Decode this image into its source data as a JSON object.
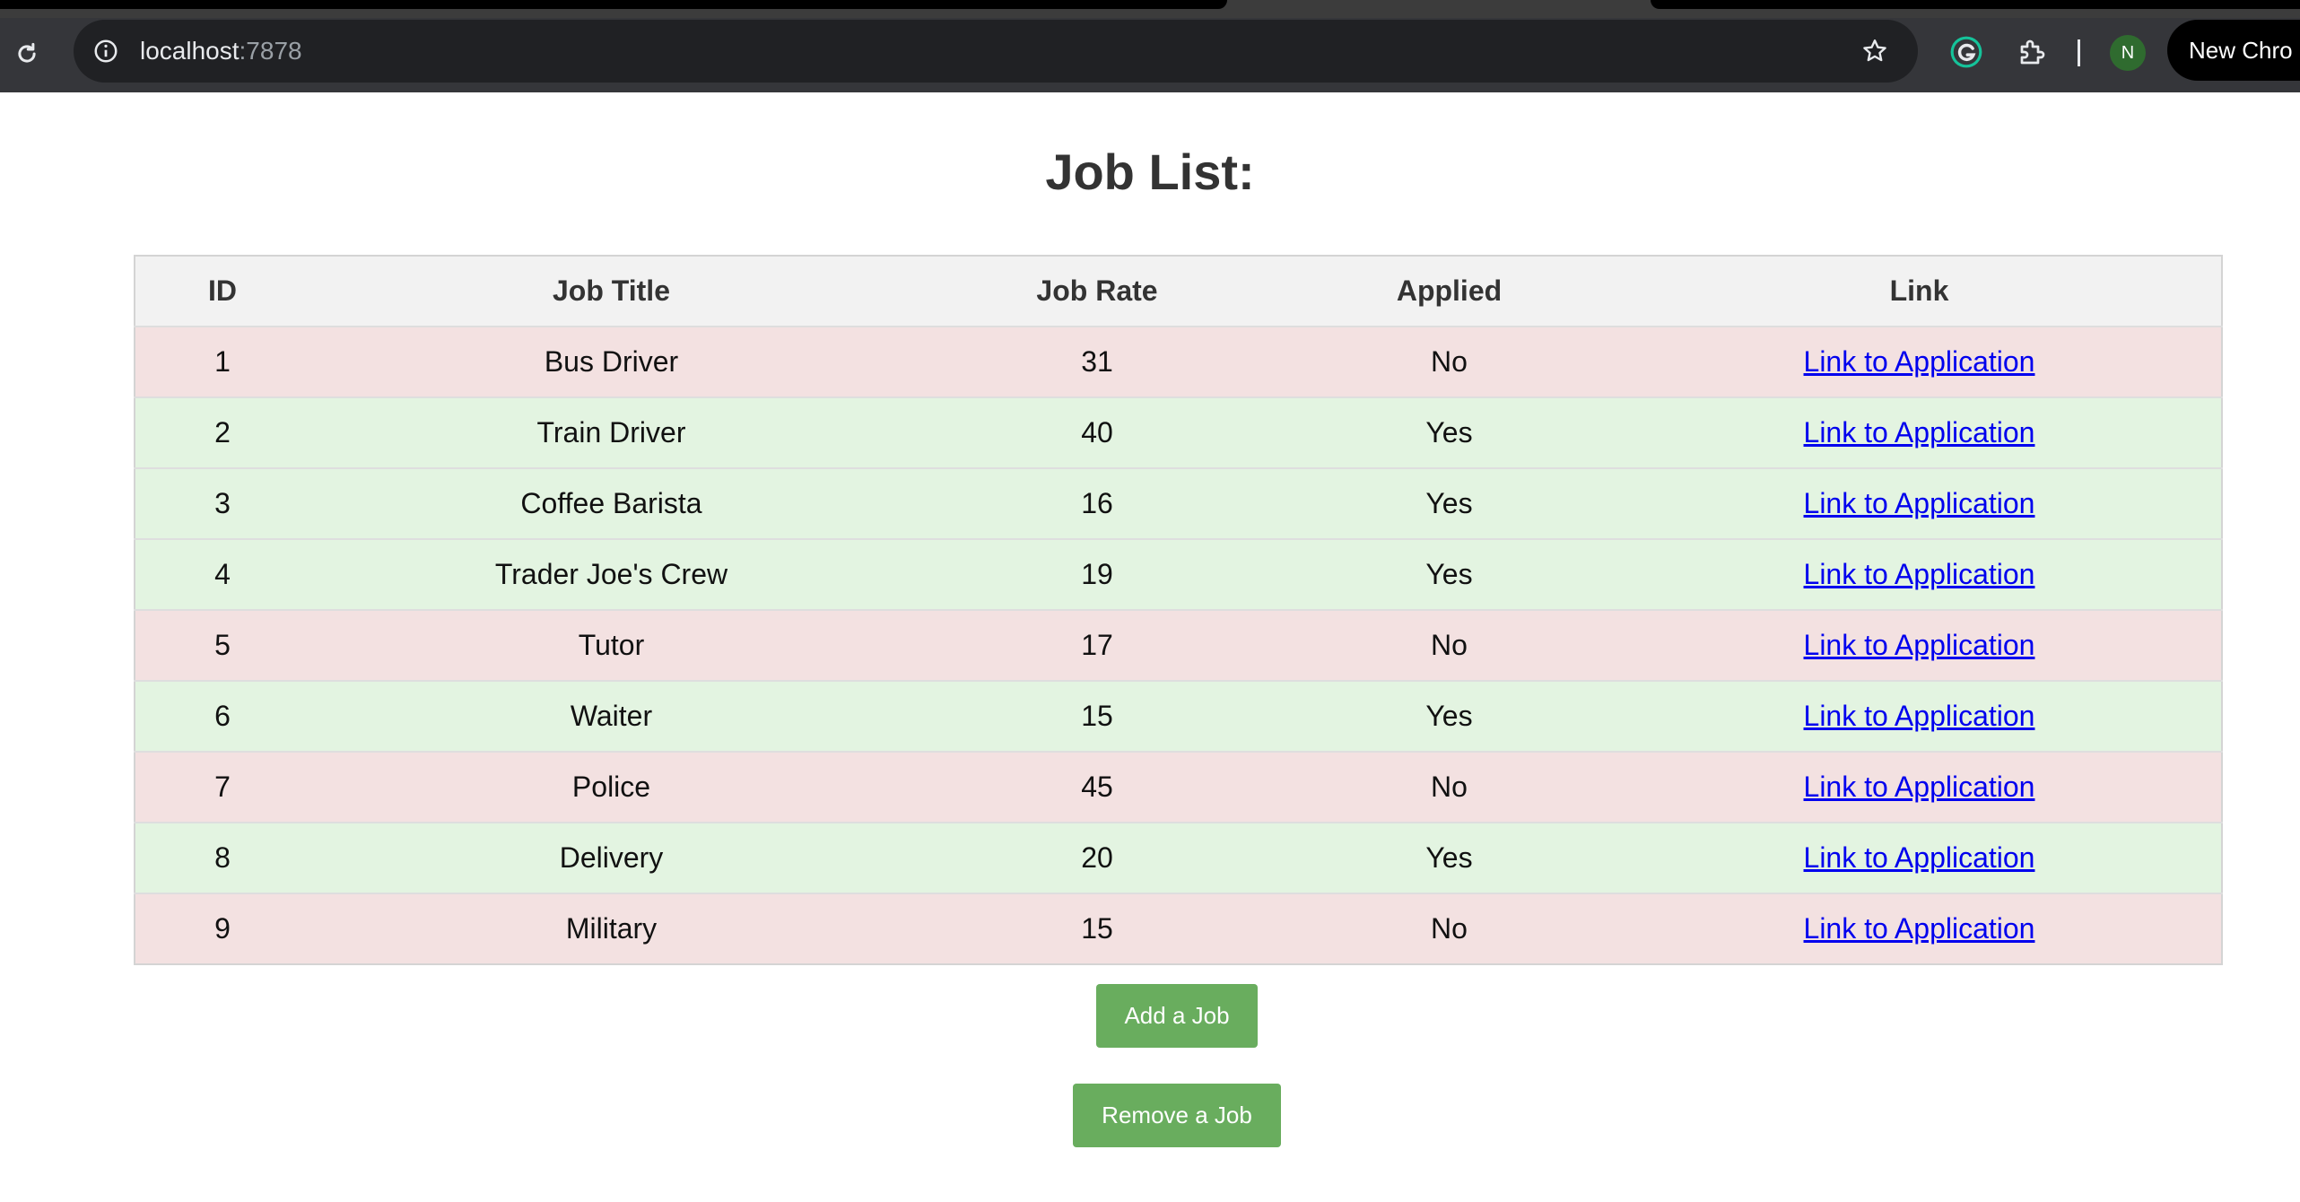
{
  "browser": {
    "url_host": "localhost",
    "url_port": ":7878",
    "reload_icon": "reload-icon",
    "info_icon": "info-icon",
    "star_icon": "star-icon",
    "extensions": [
      "grammarly-icon",
      "puzzle-icon"
    ],
    "avatar_letter": "N",
    "new_chrome_label": "New Chro"
  },
  "page": {
    "title": "Job List:"
  },
  "table": {
    "headers": [
      "ID",
      "Job Title",
      "Job Rate",
      "Applied",
      "Link"
    ],
    "rows": [
      {
        "id": "1",
        "title": "Bus Driver",
        "rate": "31",
        "applied": "No",
        "link": "Link to Application"
      },
      {
        "id": "2",
        "title": "Train Driver",
        "rate": "40",
        "applied": "Yes",
        "link": "Link to Application"
      },
      {
        "id": "3",
        "title": "Coffee Barista",
        "rate": "16",
        "applied": "Yes",
        "link": "Link to Application"
      },
      {
        "id": "4",
        "title": "Trader Joe's Crew",
        "rate": "19",
        "applied": "Yes",
        "link": "Link to Application"
      },
      {
        "id": "5",
        "title": "Tutor",
        "rate": "17",
        "applied": "No",
        "link": "Link to Application"
      },
      {
        "id": "6",
        "title": "Waiter",
        "rate": "15",
        "applied": "Yes",
        "link": "Link to Application"
      },
      {
        "id": "7",
        "title": "Police",
        "rate": "45",
        "applied": "No",
        "link": "Link to Application"
      },
      {
        "id": "8",
        "title": "Delivery",
        "rate": "20",
        "applied": "Yes",
        "link": "Link to Application"
      },
      {
        "id": "9",
        "title": "Military",
        "rate": "15",
        "applied": "No",
        "link": "Link to Application"
      }
    ]
  },
  "actions": {
    "add_label": "Add a Job",
    "remove_label": "Remove a Job"
  },
  "colors": {
    "applied_no_row": "#f3e1e1",
    "applied_yes_row": "#e3f4e1",
    "header_row": "#f2f2f2",
    "button": "#69ad5e",
    "link": "#0000ee"
  }
}
